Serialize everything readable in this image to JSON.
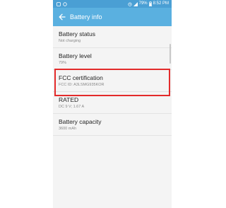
{
  "status_bar": {
    "battery_percent": "79%",
    "time": "8:52 PM"
  },
  "app_bar": {
    "title": "Battery info"
  },
  "items": [
    {
      "title": "Battery status",
      "subtitle": "Not charging"
    },
    {
      "title": "Battery level",
      "subtitle": "79%"
    },
    {
      "title": "FCC certification",
      "subtitle": "FCC ID: A3LSMG935KOR"
    },
    {
      "title": "RATED",
      "subtitle": "DC 9 V; 1.67 A"
    },
    {
      "title": "Battery capacity",
      "subtitle": "3600 mAh"
    }
  ],
  "colors": {
    "status_bar": "#4a9fd4",
    "app_bar": "#5ab0e0",
    "highlight": "#e32b2b"
  },
  "icons": {
    "back": "arrow-left",
    "alarm": "alarm-clock",
    "signal": "cellular-signal",
    "battery": "battery"
  }
}
